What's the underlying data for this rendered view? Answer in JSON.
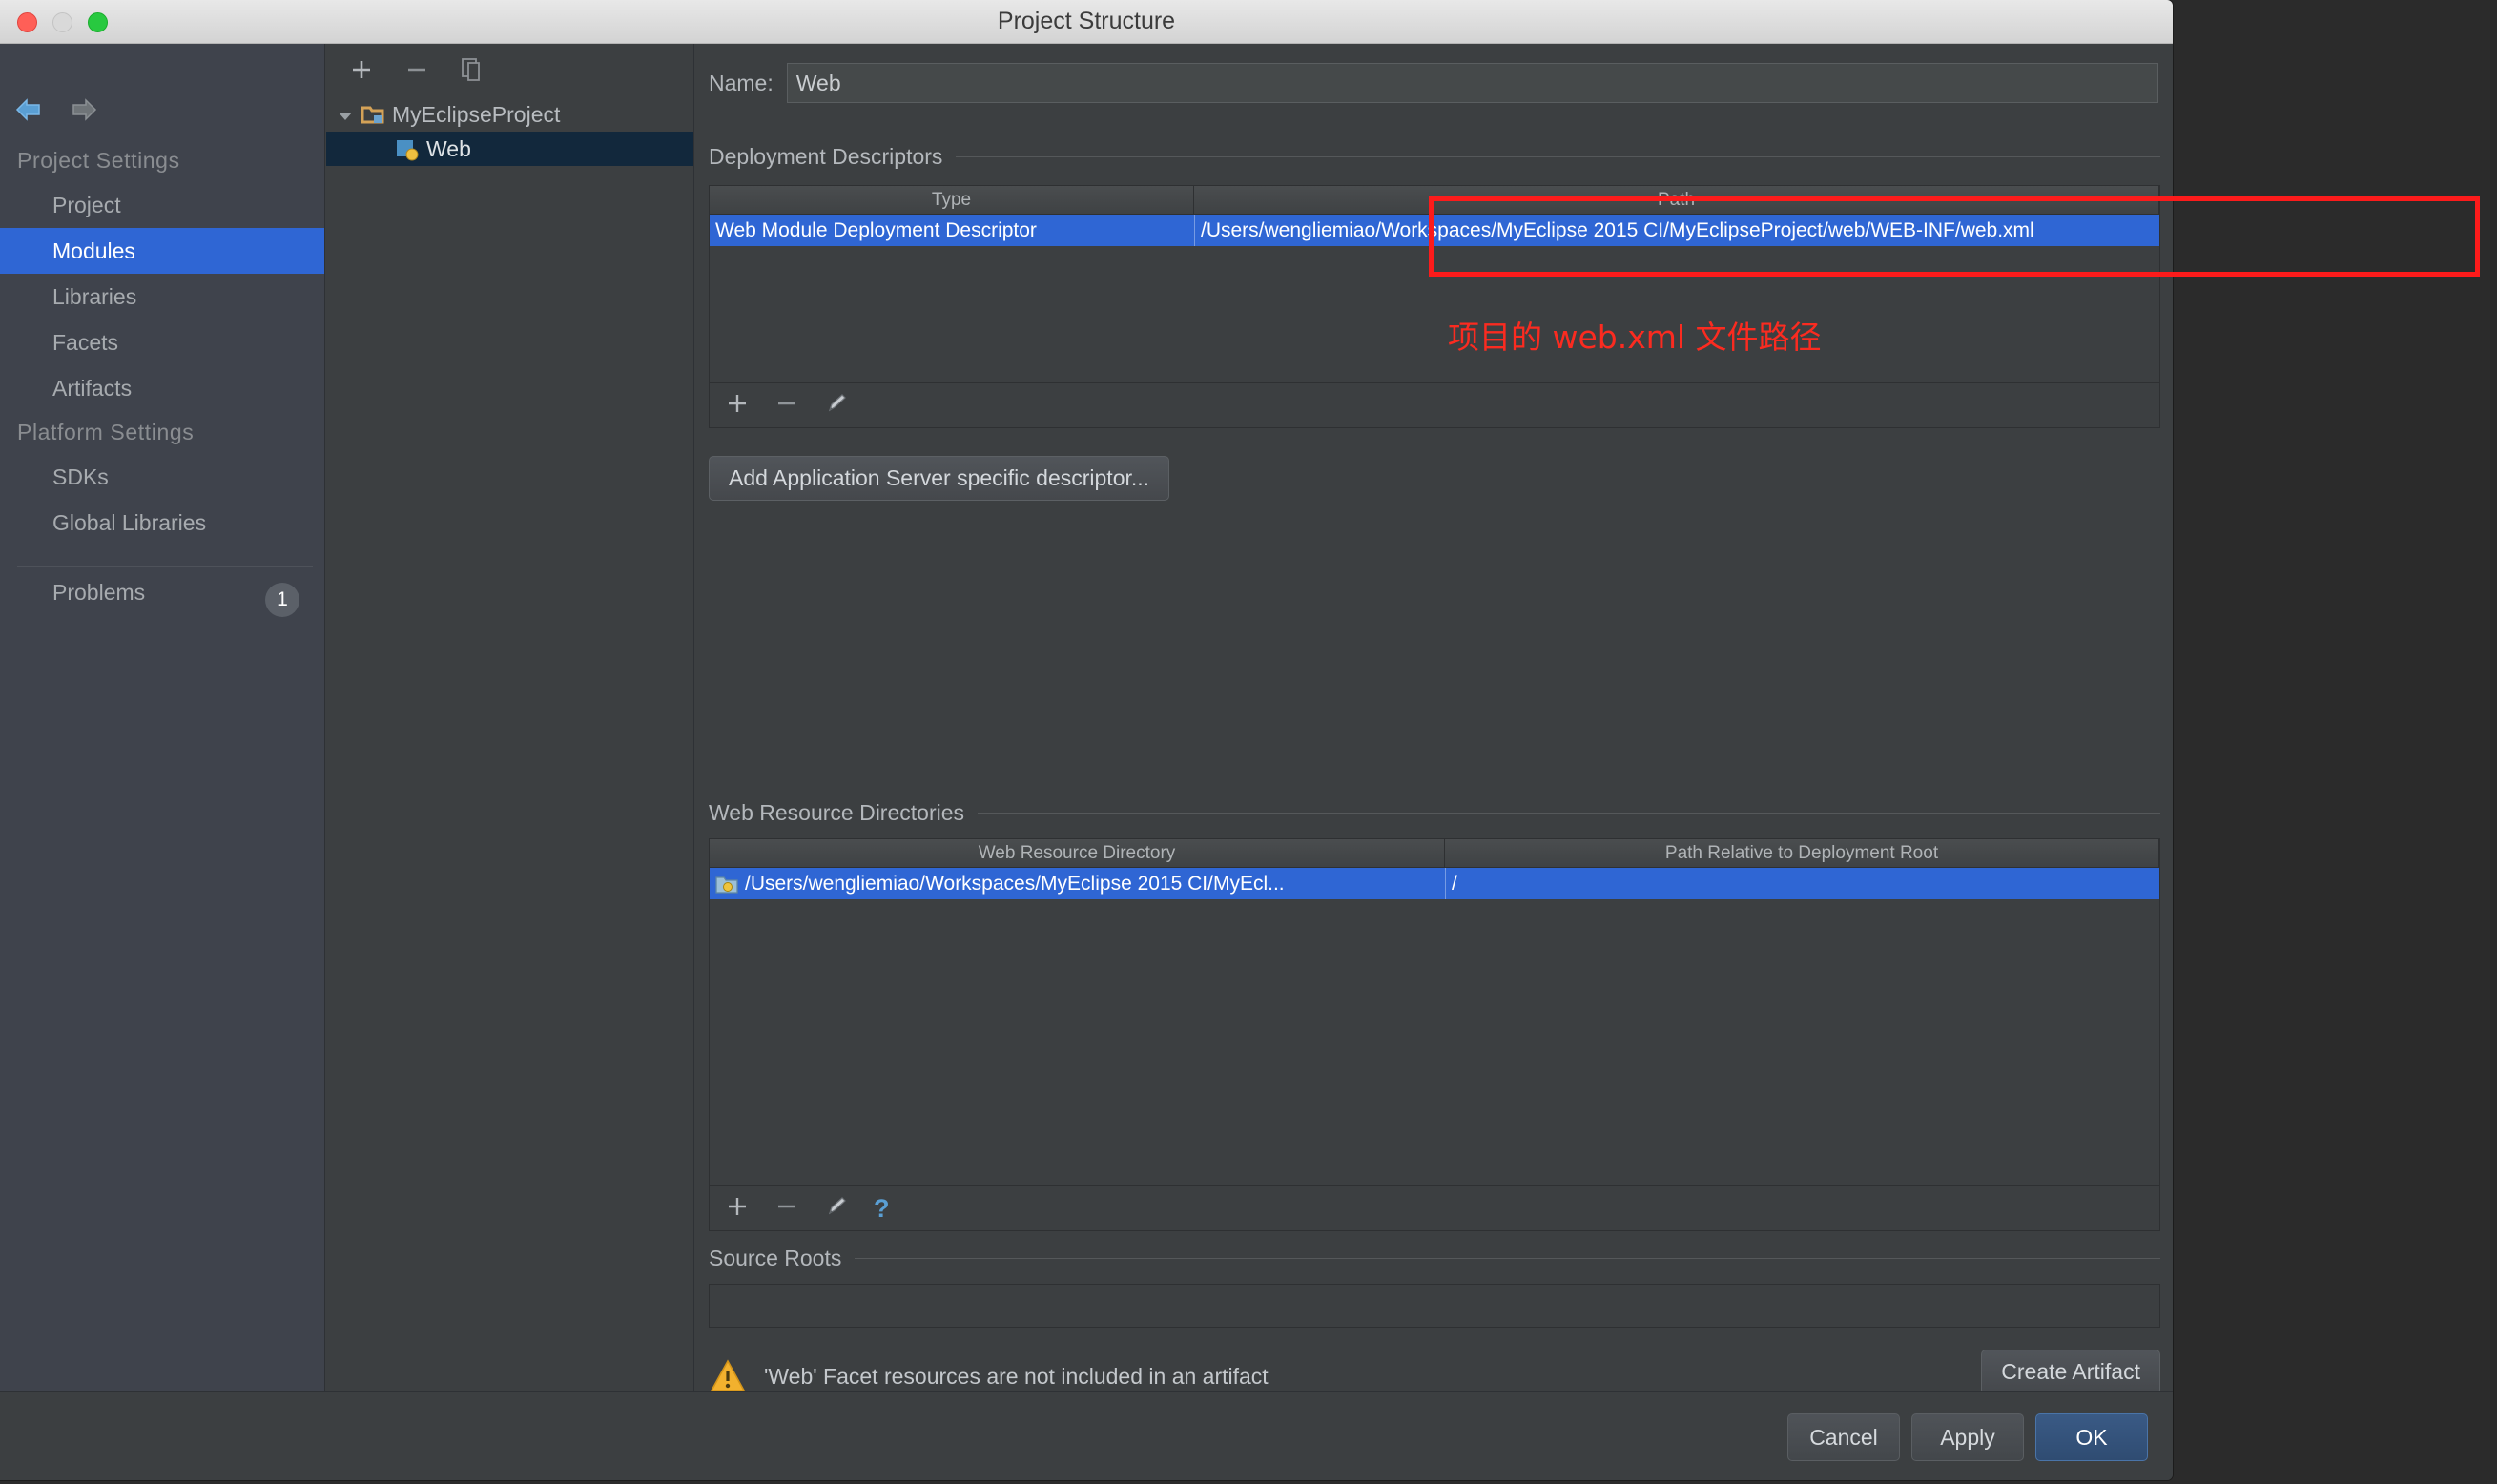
{
  "window": {
    "title": "Project Structure",
    "traffic_lights": [
      "close",
      "minimize",
      "maximize"
    ]
  },
  "sidebar": {
    "nav": {
      "back": "back-arrow",
      "forward": "forward-arrow"
    },
    "groups": [
      {
        "label": "Project Settings",
        "items": [
          {
            "label": "Project",
            "selected": false
          },
          {
            "label": "Modules",
            "selected": true
          },
          {
            "label": "Libraries",
            "selected": false
          },
          {
            "label": "Facets",
            "selected": false
          },
          {
            "label": "Artifacts",
            "selected": false
          }
        ]
      },
      {
        "label": "Platform Settings",
        "items": [
          {
            "label": "SDKs",
            "selected": false
          },
          {
            "label": "Global Libraries",
            "selected": false
          }
        ]
      }
    ],
    "problems": {
      "label": "Problems",
      "count": "1"
    },
    "help_glyph": "?"
  },
  "tree": {
    "toolbar": [
      "add-icon",
      "remove-icon",
      "copy-icon"
    ],
    "nodes": [
      {
        "label": "MyEclipseProject",
        "expanded": true,
        "selected": false,
        "icon": "module-folder-icon"
      },
      {
        "label": "Web",
        "expanded": false,
        "selected": true,
        "icon": "web-facet-icon"
      }
    ]
  },
  "main": {
    "name_field": {
      "label": "Name:",
      "value": "Web",
      "placeholder": ""
    },
    "deployment_descriptors": {
      "title": "Deployment Descriptors",
      "columns": [
        "Type",
        "Path"
      ],
      "rows": [
        {
          "type": "Web Module Deployment Descriptor",
          "path": "/Users/wengliemiao/Workspaces/MyEclipse 2015 CI/MyEclipseProject/web/WEB-INF/web.xml",
          "selected": true
        }
      ],
      "toolbar": [
        "add-icon",
        "remove-icon",
        "edit-pencil-icon"
      ],
      "add_server_descriptor_button": "Add Application Server specific descriptor..."
    },
    "web_resource_directories": {
      "title": "Web Resource Directories",
      "columns": [
        "Web Resource Directory",
        "Path Relative to Deployment Root"
      ],
      "rows": [
        {
          "directory": "/Users/wengliemiao/Workspaces/MyEclipse 2015 CI/MyEcl...",
          "relative_path": "/",
          "selected": true,
          "icon": "folder-web-icon"
        }
      ],
      "toolbar": [
        "add-icon",
        "remove-icon",
        "edit-pencil-icon",
        "help-icon"
      ]
    },
    "source_roots": {
      "title": "Source Roots"
    },
    "warning": {
      "icon": "warning-triangle-icon",
      "text": "'Web' Facet resources are not included in an artifact",
      "action_button": "Create Artifact"
    }
  },
  "footer": {
    "buttons": [
      {
        "label": "Cancel",
        "primary": false
      },
      {
        "label": "Apply",
        "primary": false
      },
      {
        "label": "OK",
        "primary": true
      }
    ]
  },
  "annotation": {
    "note": "项目的 web.xml 文件路径",
    "color": "#fb2b20"
  }
}
